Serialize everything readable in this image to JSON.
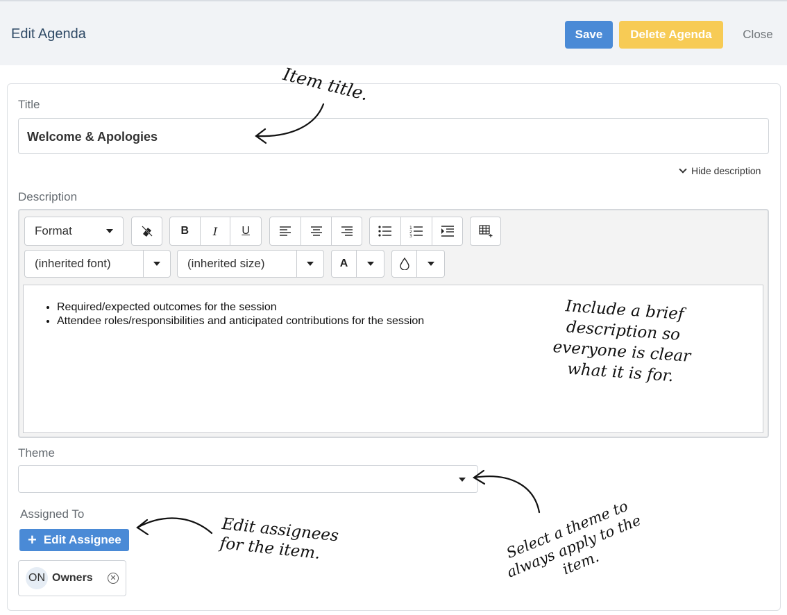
{
  "header": {
    "title": "Edit Agenda",
    "save_label": "Save",
    "delete_label": "Delete Agenda",
    "close_label": "Close"
  },
  "form": {
    "title_label": "Title",
    "title_value": "Welcome & Apologies",
    "hide_description": "Hide description",
    "description_label": "Description",
    "theme_label": "Theme",
    "theme_value": "",
    "assigned_label": "Assigned To",
    "edit_assignee_label": "Edit Assignee",
    "assignees": [
      {
        "initials": "ON",
        "name": "Owners"
      }
    ]
  },
  "editor": {
    "format_select": "Format",
    "font_select": "(inherited font)",
    "size_select": "(inherited size)",
    "font_color_glyph": "A",
    "body_items": [
      "Required/expected outcomes for the session",
      "Attendee roles/responsibilities and anticipated contributions for the session"
    ]
  },
  "annotations": {
    "title_note": "Item title.",
    "description_note": "Include a brief description so everyone is clear what it is for.",
    "assignee_note": "Edit assignees for the item.",
    "theme_note": "Select a theme to always apply to the item."
  },
  "colors": {
    "primary": "#4a8ad6",
    "warning": "#f7cb55",
    "header_bg": "#f1f3f6"
  }
}
